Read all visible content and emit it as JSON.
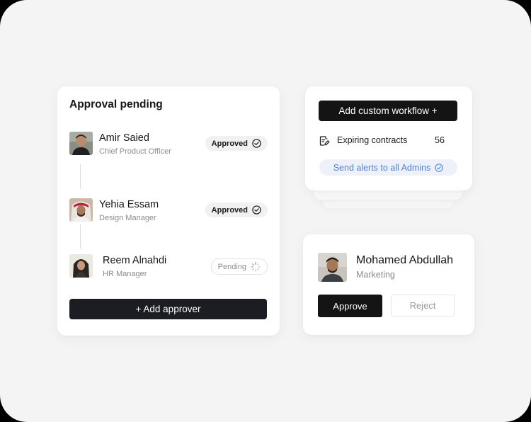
{
  "approval": {
    "title": "Approval pending",
    "approvers": [
      {
        "name": "Amir Saied",
        "role": "Chief Product Officer",
        "status": "Approved"
      },
      {
        "name": "Yehia Essam",
        "role": "Design Manager",
        "status": "Approved"
      },
      {
        "name": "Reem Alnahdi",
        "role": "HR Manager",
        "status": "Pending"
      }
    ],
    "add_button": "+ Add approver"
  },
  "workflow": {
    "add_button": "Add custom workflow +",
    "contracts_label": "Expiring contracts",
    "contracts_count": "56",
    "alert_label": "Send alerts to all Admins"
  },
  "person": {
    "name": "Mohamed Abdullah",
    "department": "Marketing",
    "approve_label": "Approve",
    "reject_label": "Reject"
  },
  "icons": {
    "approved": "check-circle-icon",
    "pending": "spinner-icon",
    "contract": "document-edit-icon",
    "alert": "check-circle-icon"
  },
  "colors": {
    "primary_button": "#141414",
    "accent_blue": "#4f83d1",
    "background": "#f4f4f5"
  }
}
